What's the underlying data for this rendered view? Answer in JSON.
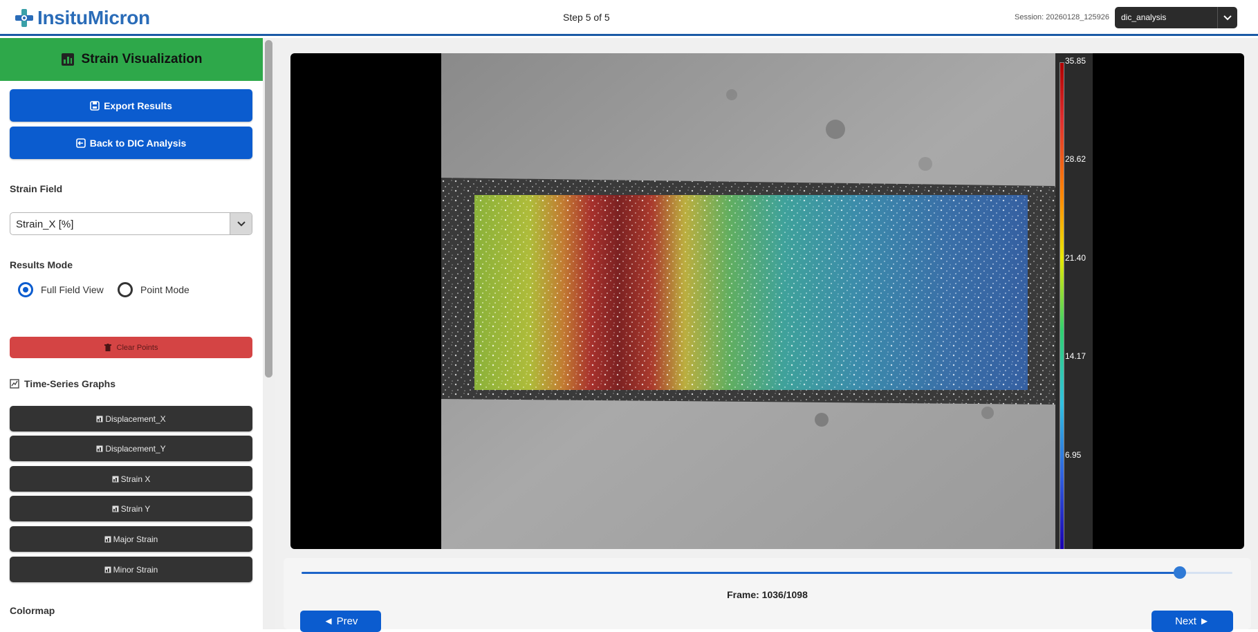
{
  "header": {
    "app_name": "InsituMicron",
    "step": "Step 5 of 5",
    "session": "Session: 20260128_125926",
    "session_select_value": "dic_analysis",
    "logo_icon": "cross-microscope-icon"
  },
  "sidebar": {
    "title": "Strain Visualization",
    "export_label": "Export Results",
    "back_label": "Back to DIC Analysis",
    "strain_field_label": "Strain Field",
    "strain_field_value": "Strain_X [%]",
    "results_mode_label": "Results Mode",
    "modes": [
      {
        "label": "Full Field View",
        "selected": true
      },
      {
        "label": "Point Mode",
        "selected": false
      }
    ],
    "clear_label": "Clear Points",
    "timeseries_title": "Time-Series Graphs",
    "graphs": [
      "Displacement_X",
      "Displacement_Y",
      "Strain X",
      "Strain Y",
      "Major Strain",
      "Minor Strain"
    ],
    "colormap_label": "Colormap"
  },
  "viewer": {
    "colorbar_labels": [
      "35.85",
      "28.62",
      "21.40",
      "14.17",
      "6.95"
    ]
  },
  "controls": {
    "frame_label": "Frame: 1036/1098",
    "frame_current": 1036,
    "frame_total": 1098,
    "prev_label": "◄ Prev",
    "next_label": "Next ►"
  },
  "colors": {
    "brand_blue": "#0b5ccf",
    "header_green": "#2ea84a",
    "danger_red": "#d44444",
    "dark_button": "#333333"
  }
}
